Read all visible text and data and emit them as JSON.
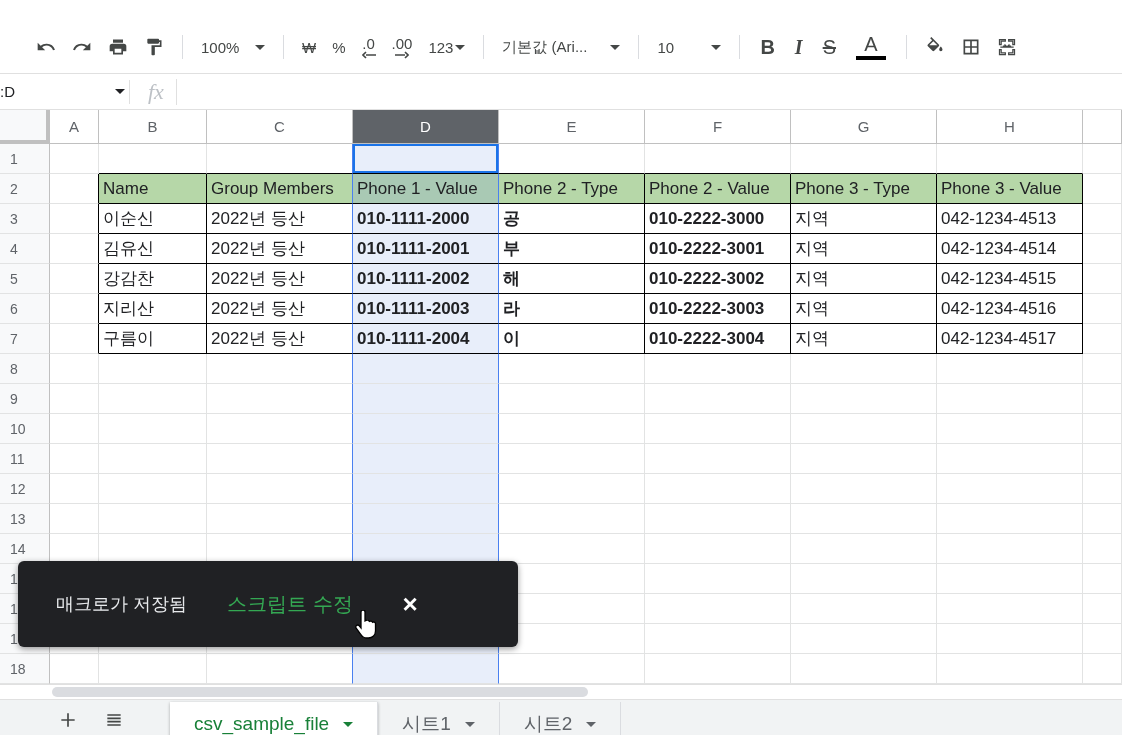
{
  "toolbar": {
    "zoom": "100%",
    "currency": "₩",
    "percent": "%",
    "decrease_decimal": ".0",
    "increase_decimal": ".00",
    "number_format": "123",
    "font": "기본값 (Ari...",
    "font_size": "10",
    "bold": "B",
    "italic": "I",
    "strikethrough": "S",
    "text_color": "A"
  },
  "formula_bar": {
    "name_box": ":D",
    "fx": "fx"
  },
  "columns": [
    {
      "letter": "A",
      "selected": false
    },
    {
      "letter": "B",
      "selected": false
    },
    {
      "letter": "C",
      "selected": false
    },
    {
      "letter": "D",
      "selected": true
    },
    {
      "letter": "E",
      "selected": false
    },
    {
      "letter": "F",
      "selected": false
    },
    {
      "letter": "G",
      "selected": false
    },
    {
      "letter": "H",
      "selected": false
    }
  ],
  "row_headers": [
    "1",
    "2",
    "3",
    "4",
    "5",
    "6",
    "7",
    "8",
    "9",
    "10",
    "11",
    "12",
    "13",
    "14",
    "1",
    "1",
    "1",
    "18"
  ],
  "table": {
    "columns": [
      {
        "title": "Name",
        "bold": false
      },
      {
        "title": "Group Members",
        "bold": false
      },
      {
        "title": "Phone 1 - Value",
        "bold": true
      },
      {
        "title": "Phone 2 - Type",
        "bold": true
      },
      {
        "title": "Phone 2 - Value",
        "bold": true
      },
      {
        "title": "Phone 3 - Type",
        "bold": false
      },
      {
        "title": "Phone 3 - Value",
        "bold": false
      }
    ],
    "rows": [
      [
        "이순신",
        "2022년 등산",
        "010-1111-2000",
        "공",
        "010-2222-3000",
        "지역",
        "042-1234-4513"
      ],
      [
        "김유신",
        "2022년 등산",
        "010-1111-2001",
        "부",
        "010-2222-3001",
        "지역",
        "042-1234-4514"
      ],
      [
        "강감찬",
        "2022년 등산",
        "010-1111-2002",
        "해",
        "010-2222-3002",
        "지역",
        "042-1234-4515"
      ],
      [
        "지리산",
        "2022년 등산",
        "010-1111-2003",
        "라",
        "010-2222-3003",
        "지역",
        "042-1234-4516"
      ],
      [
        "구름이",
        "2022년 등산",
        "010-1111-2004",
        "이",
        "010-2222-3004",
        "지역",
        "042-1234-4517"
      ]
    ]
  },
  "toast": {
    "message": "매크로가 저장됨",
    "action": "스크립트 수정",
    "close": "×"
  },
  "sheet_tabs": [
    {
      "label": "csv_sample_file",
      "selected": true
    },
    {
      "label": "시트1",
      "selected": false
    },
    {
      "label": "시트2",
      "selected": false
    }
  ]
}
